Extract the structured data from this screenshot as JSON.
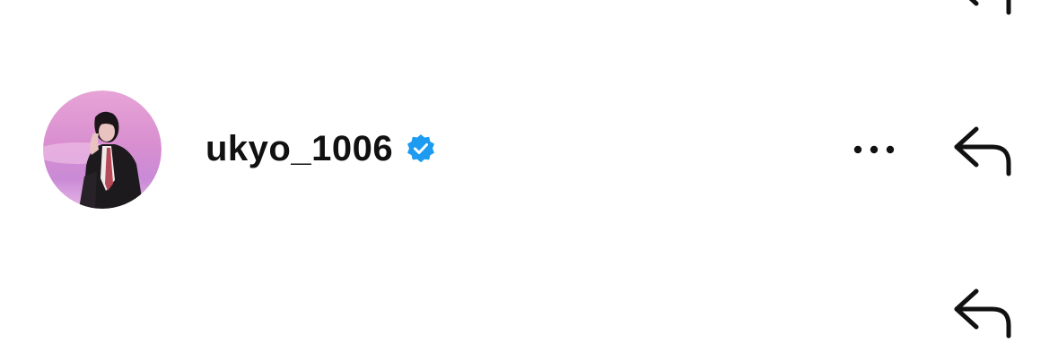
{
  "comment": {
    "username": "ukyo_1006",
    "verified": true,
    "avatar_icon": "profile-photo"
  },
  "actions": {
    "more_icon": "more-horizontal-icon",
    "reply_icon": "reply-arrow-icon"
  },
  "colors": {
    "text": "#111111",
    "verified_badge": "#1D9BF0",
    "icon": "#111111",
    "background": "#ffffff"
  }
}
